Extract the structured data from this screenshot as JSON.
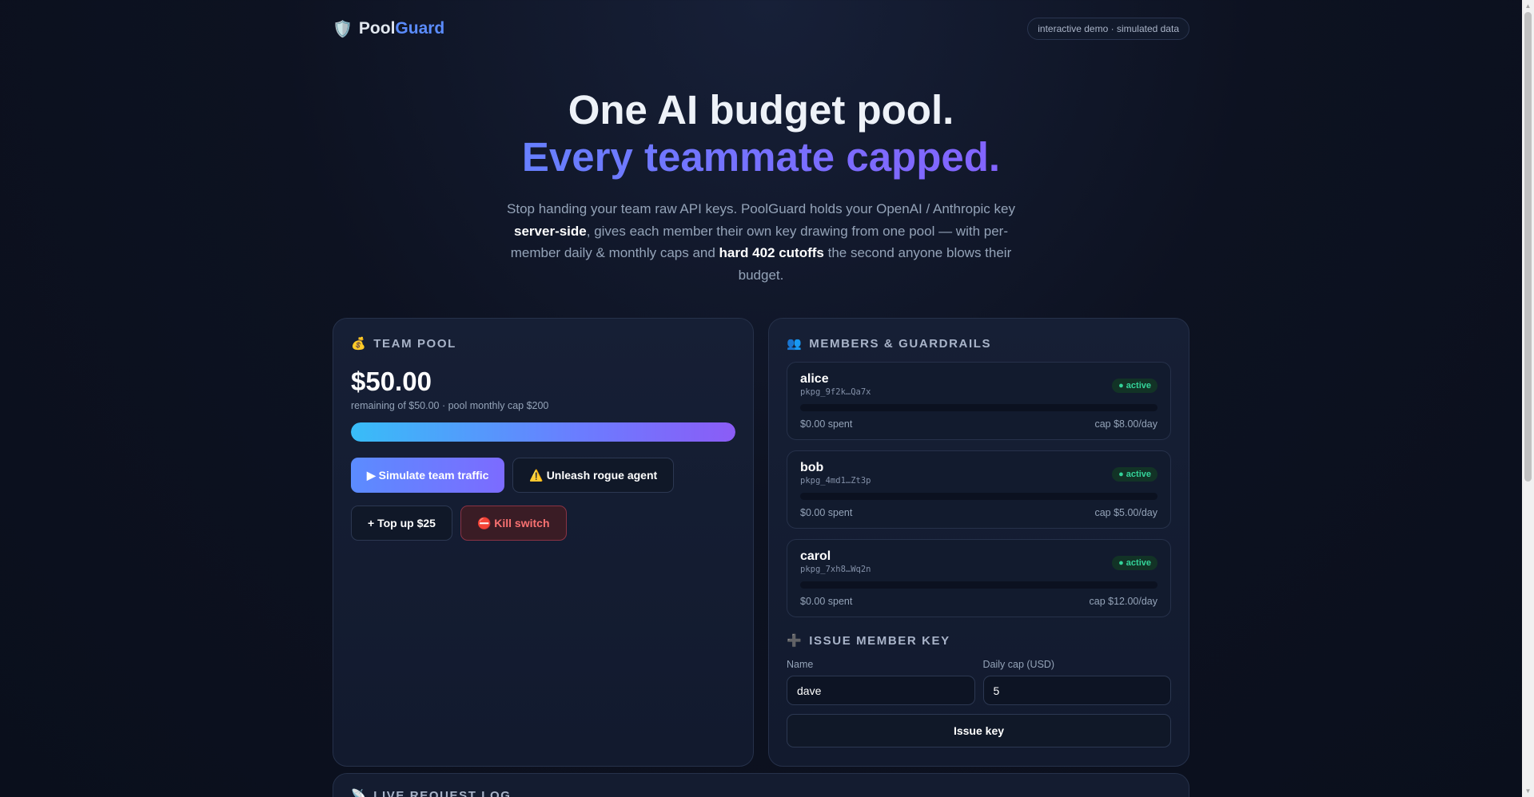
{
  "brand": {
    "shield": "🛡️",
    "name_a": "Pool",
    "name_b": "Guard"
  },
  "header": {
    "demo_label": "interactive demo · simulated data"
  },
  "hero": {
    "title_line1": "One AI budget pool.",
    "title_line2": "Every teammate capped.",
    "desc_a": "Stop handing your team raw API keys. PoolGuard holds your OpenAI / Anthropic key",
    "desc_b": "server-side",
    "desc_c": ", gives each member their own key drawing from one pool — with per-member daily & monthly caps and",
    "desc_d": "hard 402 cutoffs",
    "desc_e": "the second anyone blows their budget."
  },
  "pool": {
    "icon": "💰",
    "title": "TEAM POOL",
    "amount": "$50.00",
    "sub": "remaining of $50.00 · pool monthly cap $200",
    "fill_fraction": 1.0,
    "simulate_label": "▶ Simulate team traffic",
    "rogue_label": "⚠️ Unleash rogue agent",
    "topup_label": "+ Top up $25",
    "kill_label": "⛔ Kill switch"
  },
  "members": {
    "icon": "👥",
    "title": "MEMBERS & GUARDRAILS",
    "items": [
      {
        "name": "alice",
        "key": "pkpg_9f2k…Qa7x",
        "status": "● active",
        "spent": "$0.00 spent",
        "cap": "cap $8.00/day",
        "fill_fraction": 0
      },
      {
        "name": "bob",
        "key": "pkpg_4md1…Zt3p",
        "status": "● active",
        "spent": "$0.00 spent",
        "cap": "cap $5.00/day",
        "fill_fraction": 0
      },
      {
        "name": "carol",
        "key": "pkpg_7xh8…Wq2n",
        "status": "● active",
        "spent": "$0.00 spent",
        "cap": "cap $12.00/day",
        "fill_fraction": 0
      }
    ]
  },
  "issue": {
    "icon": "➕",
    "title": "ISSUE MEMBER KEY",
    "name_label": "Name",
    "name_value": "dave",
    "cap_label": "Daily cap (USD)",
    "cap_value": "5",
    "button_label": "Issue key"
  },
  "log": {
    "icon": "📡",
    "title": "LIVE REQUEST LOG"
  },
  "colors": {
    "accent": "#5b8cff",
    "accent2": "#8b5cf6",
    "active": "#34d399",
    "danger": "#f87171"
  }
}
